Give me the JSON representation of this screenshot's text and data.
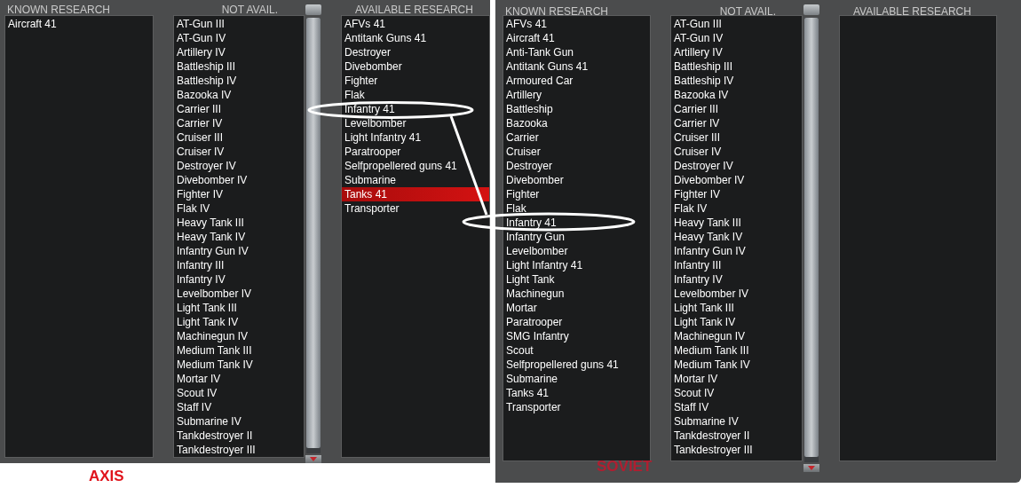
{
  "panels": [
    {
      "caption": "AXIS",
      "headers": {
        "known": "KNOWN RESEARCH",
        "not_avail": "NOT AVAIL.",
        "available": "AVAILABLE RESEARCH"
      },
      "known": [
        "Aircraft 41"
      ],
      "not_avail": [
        "AT-Gun III",
        "AT-Gun IV",
        "Artillery IV",
        "Battleship III",
        "Battleship IV",
        "Bazooka IV",
        "Carrier III",
        "Carrier IV",
        "Cruiser III",
        "Cruiser IV",
        "Destroyer IV",
        "Divebomber IV",
        "Fighter IV",
        "Flak IV",
        "Heavy Tank III",
        "Heavy Tank IV",
        "Infantry Gun IV",
        "Infantry III",
        "Infantry IV",
        "Levelbomber IV",
        "Light Tank III",
        "Light Tank IV",
        "Machinegun IV",
        "Medium Tank III",
        "Medium Tank IV",
        "Mortar IV",
        "Scout IV",
        "Staff IV",
        "Submarine IV",
        "Tankdestroyer II",
        "Tankdestroyer III"
      ],
      "available": [
        {
          "label": "AFVs 41",
          "selected": false
        },
        {
          "label": "Antitank Guns 41",
          "selected": false
        },
        {
          "label": "Destroyer",
          "selected": false
        },
        {
          "label": "Divebomber",
          "selected": false
        },
        {
          "label": "Fighter",
          "selected": false
        },
        {
          "label": "Flak",
          "selected": false
        },
        {
          "label": "Infantry 41",
          "selected": false
        },
        {
          "label": "Levelbomber",
          "selected": false
        },
        {
          "label": "Light Infantry 41",
          "selected": false
        },
        {
          "label": "Paratrooper",
          "selected": false
        },
        {
          "label": "Selfpropellered guns 41",
          "selected": false
        },
        {
          "label": "Submarine",
          "selected": false
        },
        {
          "label": "Tanks 41",
          "selected": true
        },
        {
          "label": "Transporter",
          "selected": false
        }
      ]
    },
    {
      "caption": "SOVIET",
      "headers": {
        "known": "KNOWN RESEARCH",
        "not_avail": "NOT AVAIL.",
        "available": "AVAILABLE RESEARCH"
      },
      "known": [
        "AFVs 41",
        "Aircraft 41",
        "Anti-Tank Gun",
        "Antitank Guns 41",
        "Armoured Car",
        "Artillery",
        "Battleship",
        "Bazooka",
        "Carrier",
        "Cruiser",
        "Destroyer",
        "Divebomber",
        "Fighter",
        "Flak",
        "Infantry 41",
        "Infantry Gun",
        "Levelbomber",
        "Light Infantry 41",
        "Light Tank",
        "Machinegun",
        "Mortar",
        "Paratrooper",
        "SMG Infantry",
        "Scout",
        "Selfpropellered guns 41",
        "Submarine",
        "Tanks 41",
        "Transporter"
      ],
      "not_avail": [
        "AT-Gun III",
        "AT-Gun IV",
        "Artillery IV",
        "Battleship III",
        "Battleship IV",
        "Bazooka IV",
        "Carrier III",
        "Carrier IV",
        "Cruiser III",
        "Cruiser IV",
        "Destroyer IV",
        "Divebomber IV",
        "Fighter IV",
        "Flak IV",
        "Heavy Tank III",
        "Heavy Tank IV",
        "Infantry Gun IV",
        "Infantry III",
        "Infantry IV",
        "Levelbomber IV",
        "Light Tank III",
        "Light Tank IV",
        "Machinegun IV",
        "Medium Tank III",
        "Medium Tank IV",
        "Mortar IV",
        "Scout IV",
        "Staff IV",
        "Submarine IV",
        "Tankdestroyer II",
        "Tankdestroyer III"
      ]
    }
  ]
}
